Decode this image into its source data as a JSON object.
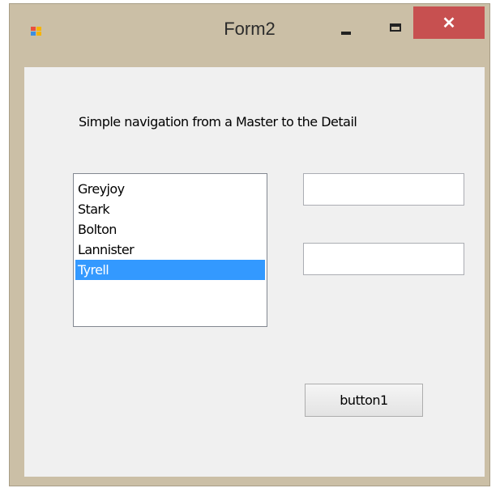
{
  "window": {
    "title": "Form2",
    "close_glyph": "✕",
    "icon": "windows-form-icon",
    "minimize_icon": "minimize-icon",
    "maximize_icon": "maximize-icon",
    "close_color": "#c75050"
  },
  "form": {
    "caption": "Simple navigation from a Master to the Detail",
    "list_items": [
      {
        "label": "Greyjoy",
        "selected": false
      },
      {
        "label": "Stark",
        "selected": false
      },
      {
        "label": "Bolton",
        "selected": false
      },
      {
        "label": "Lannister",
        "selected": false
      },
      {
        "label": "Tyrell",
        "selected": true
      }
    ],
    "textbox1_value": "",
    "textbox2_value": "",
    "button_label": "button1",
    "selection_color": "#3399ff"
  }
}
